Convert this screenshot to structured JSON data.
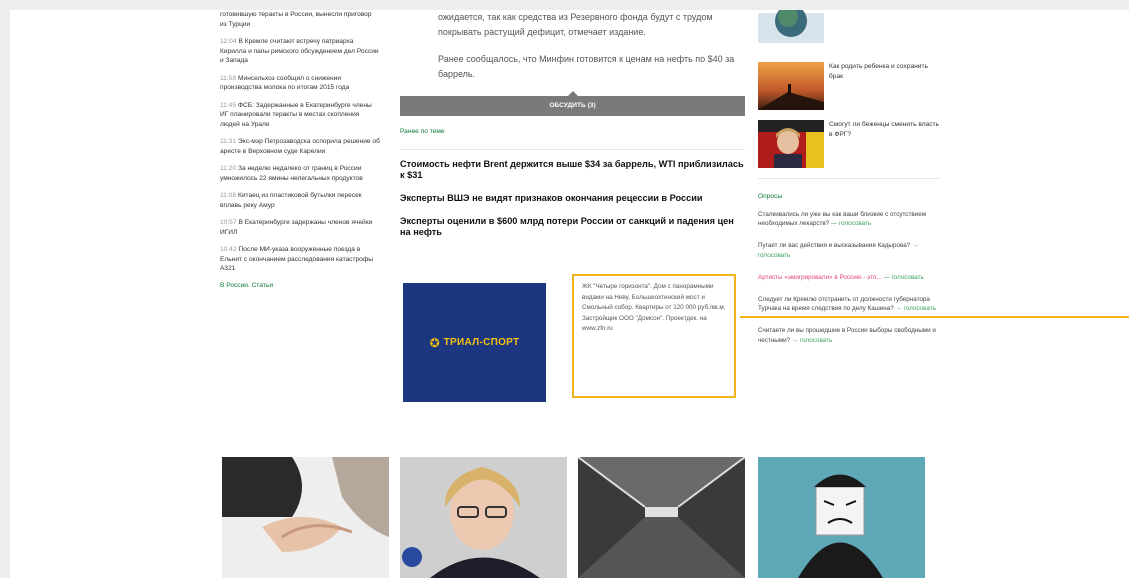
{
  "left_news": [
    {
      "time": "",
      "text": "готовившую теракты в России, вынесли приговор из Турции"
    },
    {
      "time": "12:04",
      "text": "В Кремле считают встречу патриарха Кирилла и папы римского обсуждением дел России и Запада"
    },
    {
      "time": "11:58",
      "text": "Минсельхоз сообщил о снижении производства молока по итогам 2015 года"
    },
    {
      "time": "11:45",
      "text": "ФСБ: Задержанные в Екатеринбурге члены ИГ планировали теракты в местах скопления людей на Урале"
    },
    {
      "time": "11:31",
      "text": "Экс-мэр Петрозаводска оспорила решение об аресте в Верховном суде Карелии"
    },
    {
      "time": "11:20",
      "text": "За неделю недалеко от границ в России умножилось 22 ямины нелегальных продуктов"
    },
    {
      "time": "11:08",
      "text": "Китаец из пластиковой бутылки пересек вплавь реку Амур"
    },
    {
      "time": "10:57",
      "text": "В Екатеринбурге задержаны членов ячейки ИГИЛ"
    },
    {
      "time": "10:42",
      "text": "После МИ-указа вооруженные поезда в Ельнит с окончанием расследования катастрофы А321"
    }
  ],
  "left_link": "В России. Статьи",
  "article": {
    "para1": "ожидается, так как средства из Резервного фонда будут с трудом покрывать растущий дефицит, отмечает издание.",
    "para2": "Ранее сообщалось, что Минфин готовится к ценам на нефть по $40 за баррель."
  },
  "discuss_label": "ОБСУДИТЬ (3)",
  "related_label": "Ранее по теме",
  "headlines": [
    "Стоимость нефти Brent держится выше $34 за баррель, WTI приблизилась к $31",
    "Эксперты ВШЭ не видят признаков окончания рецессии в России",
    "Эксперты оценили в $600 млрд потери России от санкций и падения цен на нефть"
  ],
  "ad": {
    "logo_mark": "✪",
    "logo_text": "ТРИАЛ-СПОРТ",
    "text": "ЖК \"Четыре горизонта\". Дом с панорамными видами на Неву, Большеохтинский мост и Смольный собор. Квартиры от 120 000 руб./кв.м. Застройщик ООО \"Домсон\". Проектдек. на www.zfn.ru"
  },
  "right_thumbs": [
    {
      "text": ""
    },
    {
      "text": "Как родить ребенка и сохранить брак"
    },
    {
      "text": "Смогут ли беженцы сменить власть в ФРГ?"
    }
  ],
  "polls_title": "Опросы",
  "polls": [
    {
      "q": "Сталкивались ли уже вы как ваши близкие с отсутствием необходимых лекарств?",
      "vote": "— голосовать",
      "pink": false
    },
    {
      "q": "Пугает ли вас действия и высказывания Кадырова?",
      "vote": "→ голосовать",
      "pink": false
    },
    {
      "q": "Артисты «эмигрировали» в Россию - это...",
      "vote": "— голосовать",
      "pink": true
    },
    {
      "q": "Следует ли Кремлю отстранить от должности губернатора Турчака на время следствия по делу Кашина?",
      "vote": "→ голосовать",
      "pink": false
    },
    {
      "q": "Считаете ли вы прошедшие в России выборы свободными и честными?",
      "vote": "→ голосовать",
      "pink": false
    }
  ],
  "colors": {
    "accent": "#0a7a3a",
    "callout": "#f2b51d",
    "ad_bg": "#1d3680",
    "ad_logo": "#f4c20d",
    "pink": "#e0457b"
  }
}
